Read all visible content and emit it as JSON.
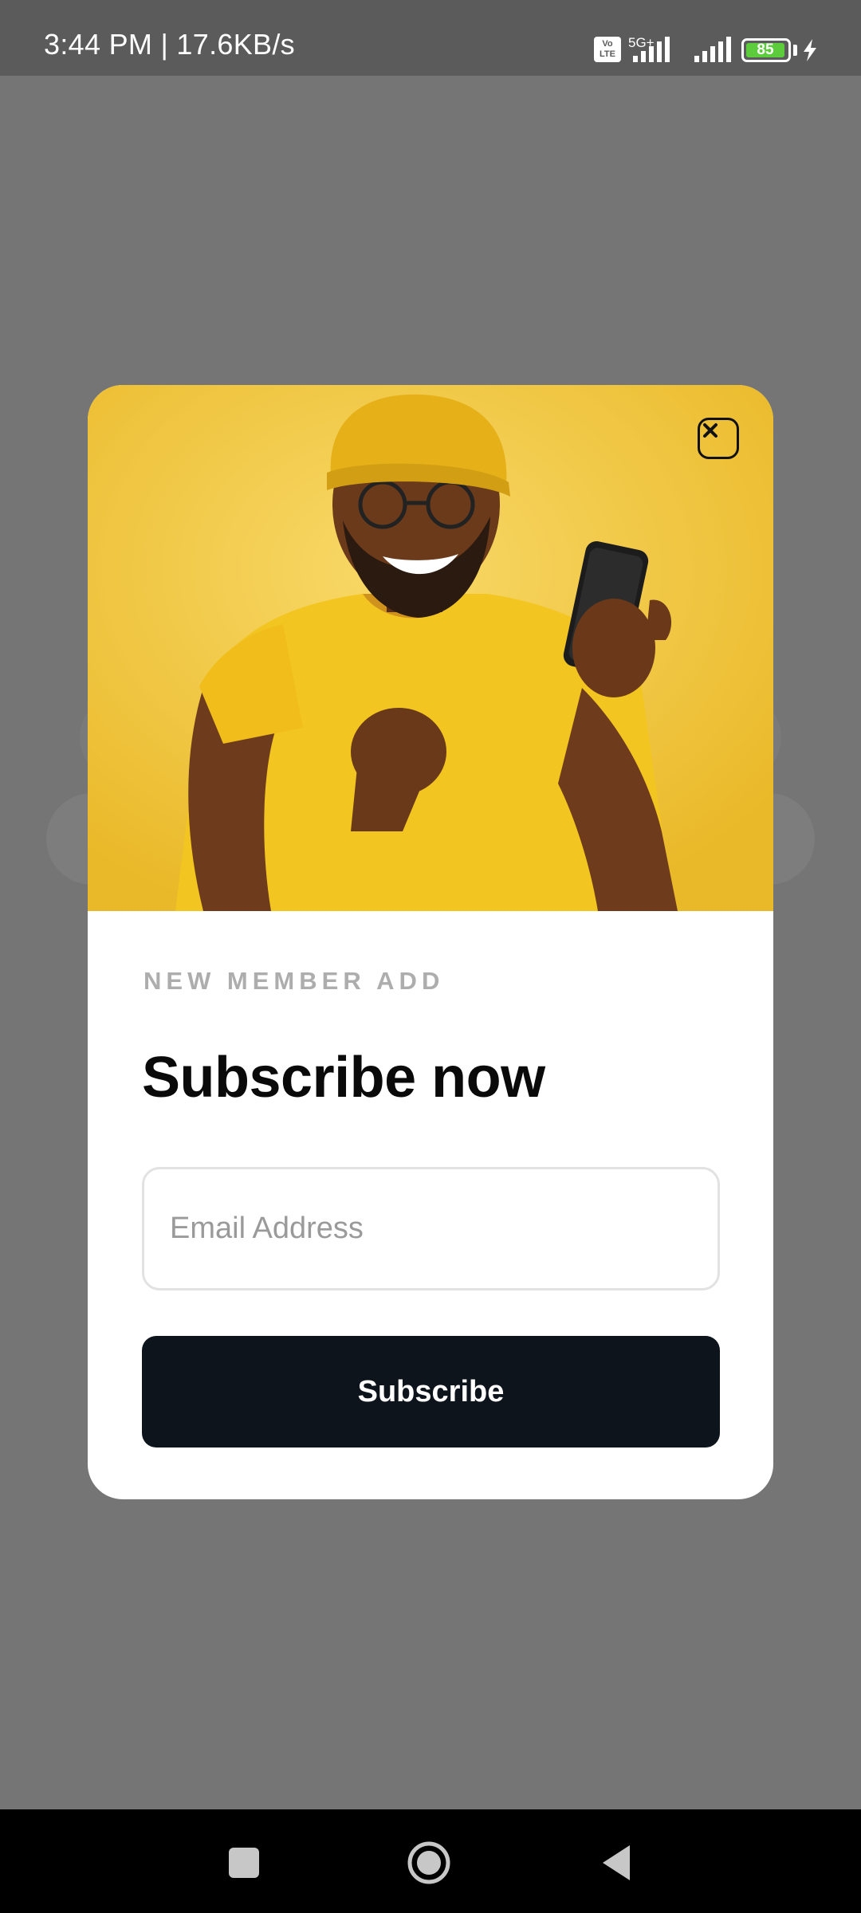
{
  "status_bar": {
    "text": "3:44 PM | 17.6KB/s",
    "volte": "Vo\nLTE",
    "network": "5G+",
    "battery": "85"
  },
  "modal": {
    "eyebrow": "NEW MEMBER ADD",
    "title": "Subscribe now",
    "email_placeholder": "Email Address",
    "email_value": "",
    "button_label": "Subscribe",
    "accent_color": "#0e141c",
    "hero_color": "#efc230"
  },
  "icons": {
    "close": "close-icon",
    "recent": "recent-apps-icon",
    "home": "home-icon",
    "back": "back-icon"
  }
}
